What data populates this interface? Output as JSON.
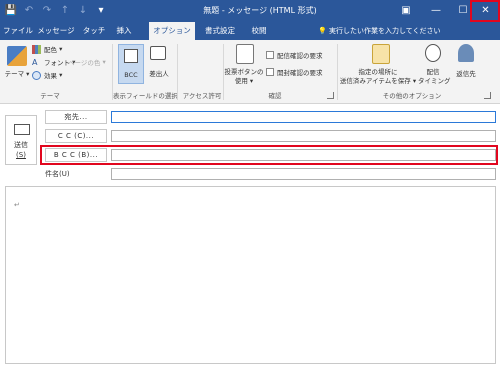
{
  "window": {
    "title": "無題 - メッセージ (HTML 形式)",
    "controls": {
      "ribbon_options": "▣",
      "minimize": "—",
      "maximize": "☐",
      "close": "✕"
    }
  },
  "quick_access": {
    "save_icon": "💾",
    "undo_icon": "↶",
    "redo_icon": "↷",
    "up_icon": "↑",
    "down_icon": "↓",
    "customize_icon": "▾"
  },
  "tabs": [
    {
      "label": "ファイル",
      "active": false
    },
    {
      "label": "メッセージ",
      "active": false
    },
    {
      "label": "タッチ",
      "active": false
    },
    {
      "label": "挿入",
      "active": false
    },
    {
      "label": "オプション",
      "active": true
    },
    {
      "label": "書式設定",
      "active": false
    },
    {
      "label": "校閲",
      "active": false
    }
  ],
  "tell_me": {
    "icon": "💡",
    "text": "実行したい作業を入力してください"
  },
  "ribbon": {
    "theme": {
      "label": "テーマ",
      "colors": "配色",
      "fonts": "フォント",
      "effects": "効果",
      "page_color": "ページの色",
      "group": "テーマ"
    },
    "show_fields": {
      "bcc": "BCC",
      "from": "差出人",
      "group": "表示フィールドの選択"
    },
    "permission": {
      "group": "アクセス許可"
    },
    "tracking": {
      "voting": "投票ボタンの",
      "voting2": "使用",
      "delivery_receipt": "配信確認の要求",
      "read_receipt": "開封確認の要求",
      "group": "確認"
    },
    "more": {
      "save_sent_line1": "指定の場所に",
      "save_sent_line2": "送信済みアイテムを保存",
      "delay_line1": "配信",
      "delay_line2": "タイミング",
      "reply_to": "返信先",
      "group": "その他のオプション"
    }
  },
  "compose": {
    "send": {
      "label": "送信",
      "shortcut": "(S)"
    },
    "to_button": "宛先...",
    "cc_button": "C C (C)...",
    "bcc_button": "B C C (B)...",
    "subject_label": "件名(U)",
    "body_mark": "↵"
  },
  "colors": {
    "brand": "#2b579a",
    "highlight": "#e1061e"
  }
}
